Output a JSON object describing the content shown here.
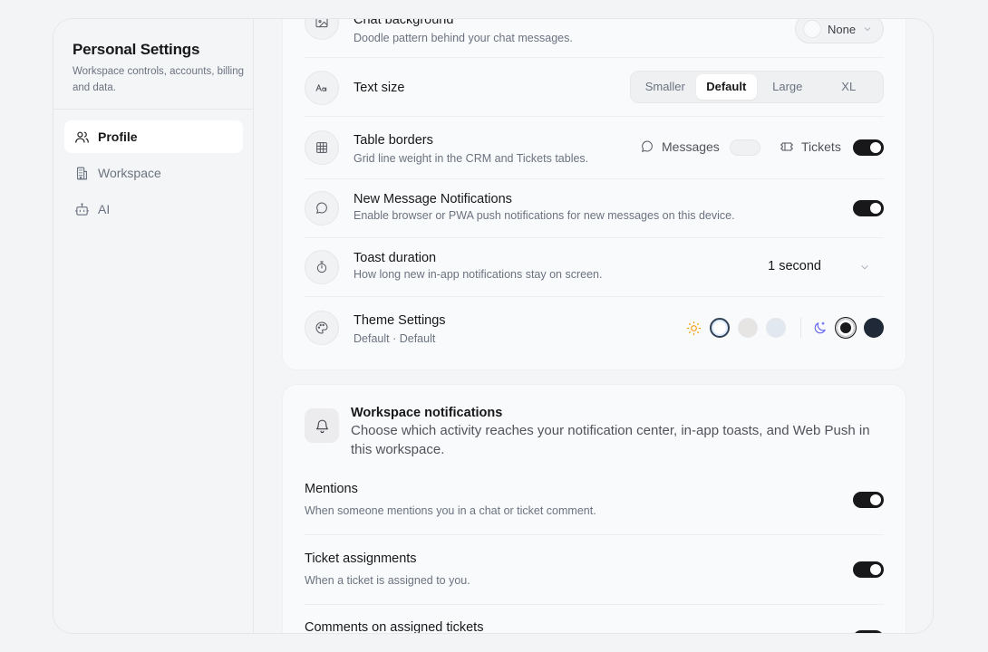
{
  "sidebar": {
    "title": "Personal Settings",
    "subtitle": "Workspace controls, accounts, billing and data.",
    "items": [
      {
        "label": "Profile",
        "icon": "users-icon",
        "active": true
      },
      {
        "label": "Workspace",
        "icon": "building-icon",
        "active": false
      },
      {
        "label": "AI",
        "icon": "bot-icon",
        "active": false
      }
    ]
  },
  "appearance": {
    "chat_background": {
      "title": "Chat background",
      "description": "Doodle pattern behind your chat messages.",
      "value": "None"
    },
    "text_size": {
      "title": "Text size",
      "options": [
        "Smaller",
        "Default",
        "Large",
        "XL"
      ],
      "selected": "Default"
    },
    "table_borders": {
      "title": "Table borders",
      "description": "Grid line weight in the CRM and Tickets tables.",
      "messages_label": "Messages",
      "messages_on": false,
      "tickets_label": "Tickets",
      "tickets_on": true
    },
    "new_message_notifications": {
      "title": "New Message Notifications",
      "description": "Enable browser or PWA push notifications for new messages on this device.",
      "on": true
    },
    "toast_duration": {
      "title": "Toast duration",
      "description": "How long new in-app notifications stay on screen.",
      "value": "1 second"
    },
    "theme_settings": {
      "title": "Theme Settings",
      "description": "Default · Default",
      "light_swatches": [
        "#ffffff",
        "#e7e5e4",
        "#e2e8f0"
      ],
      "dark_swatches": [
        "#18181b",
        "#1f2937"
      ],
      "sun_color": "#f59e0b",
      "moon_color": "#6366f1"
    }
  },
  "workspace_notifications": {
    "title": "Workspace notifications",
    "description": "Choose which activity reaches your notification center, in-app toasts, and Web Push in this workspace.",
    "items": [
      {
        "title": "Mentions",
        "description": "When someone mentions you in a chat or ticket comment.",
        "on": true
      },
      {
        "title": "Ticket assignments",
        "description": "When a ticket is assigned to you.",
        "on": true
      },
      {
        "title": "Comments on assigned tickets",
        "description": "",
        "on": true
      }
    ]
  }
}
